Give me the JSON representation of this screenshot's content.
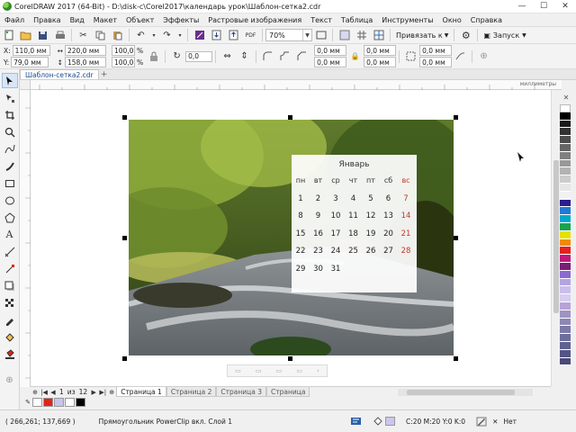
{
  "window": {
    "title": "CorelDRAW 2017 (64-Bit) - D:\\disk-c\\Corel2017\\календарь урок\\Шаблон-сетка2.cdr",
    "minimize": "—",
    "maximize": "☐",
    "close": "✕"
  },
  "menu": {
    "items": [
      "Файл",
      "Правка",
      "Вид",
      "Макет",
      "Объект",
      "Эффекты",
      "Растровые изображения",
      "Текст",
      "Таблица",
      "Инструменты",
      "Окно",
      "Справка"
    ]
  },
  "toolbar1": {
    "zoom": "70%",
    "snap_label": "Привязать к",
    "launch_label": "Запуск"
  },
  "toolbar2": {
    "x_label": "X:",
    "x_value": "110,0 мм",
    "y_label": "Y:",
    "y_value": "79,0 мм",
    "w_value": "220,0 мм",
    "h_value": "158,0 мм",
    "scale_w": "100,0",
    "scale_h": "100,0",
    "percent": "%",
    "rotation": "0,0",
    "corner_a": "0,0 мм",
    "corner_b": "0,0 мм",
    "corner_c": "0,0 мм",
    "corner_d": "0,0 мм",
    "corner_e": "0,0 мм",
    "corner_f": "0,0 мм"
  },
  "doc_tab": {
    "label": "Шаблон-сетка2.cdr",
    "add": "+"
  },
  "ruler": {
    "unit": "миллиметры"
  },
  "calendar": {
    "month": "Январь",
    "weekdays": [
      "пн",
      "вт",
      "ср",
      "чт",
      "пт",
      "сб",
      "вс"
    ],
    "weeks": [
      [
        "",
        "",
        "",
        "",
        "",
        "",
        ""
      ],
      [
        "1",
        "2",
        "3",
        "4",
        "5",
        "6",
        "7"
      ],
      [
        "8",
        "9",
        "10",
        "11",
        "12",
        "13",
        "14"
      ],
      [
        "15",
        "16",
        "17",
        "18",
        "19",
        "20",
        "21"
      ],
      [
        "22",
        "23",
        "24",
        "25",
        "26",
        "27",
        "28"
      ],
      [
        "29",
        "30",
        "31",
        "",
        "",
        "",
        ""
      ]
    ]
  },
  "page_nav": {
    "current": "1",
    "of_label": "из",
    "total": "12",
    "tabs": [
      "Страница 1",
      "Страница 2",
      "Страница 3",
      "Страница"
    ]
  },
  "status": {
    "coords": "( 266,261; 137,669 )",
    "object_info": "Прямоугольник PowerClip вкл. Слой 1",
    "fill_info": "C:20 M:20 Y:0 K:0",
    "outline_info": "Нет"
  },
  "palette_colors": [
    "#ffffff",
    "#000000",
    "#1a1a1a",
    "#333333",
    "#4d4d4d",
    "#666666",
    "#808080",
    "#999999",
    "#b3b3b3",
    "#cccccc",
    "#e6e6e6",
    "#f2f2f2",
    "#2b1d8f",
    "#1f7ad6",
    "#00a9c9",
    "#1aa34a",
    "#e8e000",
    "#f08c00",
    "#e2231a",
    "#c2187a",
    "#7a1e7a",
    "#8a6ad1",
    "#b5a4e3",
    "#c9bfeb",
    "#d6cdf0",
    "#b8a2d8",
    "#9f93c4",
    "#8d87b5",
    "#7c7aa8",
    "#6e6e9c",
    "#616190",
    "#555585",
    "#4a4a78"
  ],
  "colors": {
    "accent": "#1a4a8a",
    "sunday": "#c0392b"
  }
}
